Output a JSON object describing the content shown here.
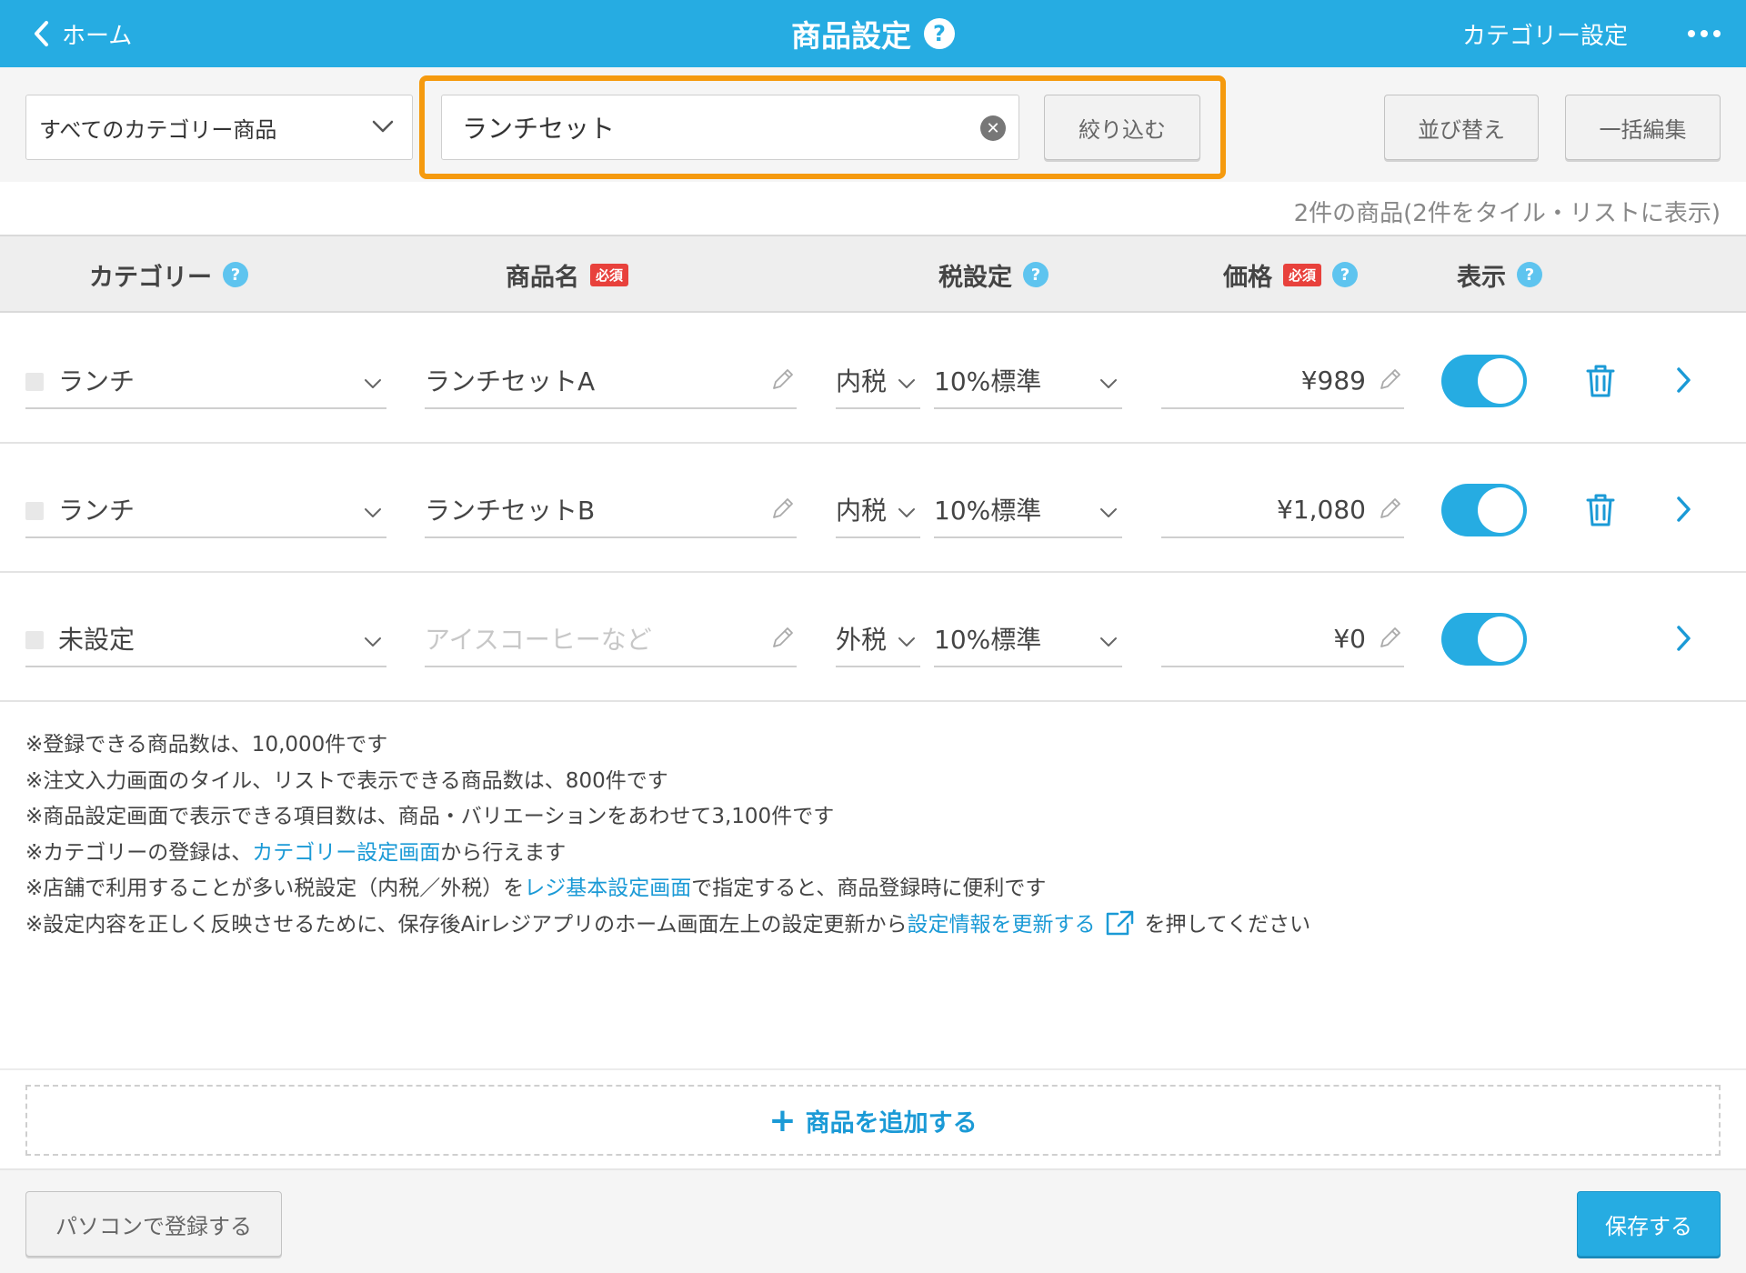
{
  "header": {
    "back_label": "ホーム",
    "title": "商品設定",
    "help": "?",
    "category_settings": "カテゴリー設定"
  },
  "toolbar": {
    "category_filter": "すべてのカテゴリー商品",
    "search_value": "ランチセット",
    "filter_button": "絞り込む",
    "sort_button": "並び替え",
    "bulk_edit_button": "一括編集"
  },
  "summary": "2件の商品(2件をタイル・リストに表示)",
  "table": {
    "columns": {
      "category": "カテゴリー",
      "name": "商品名",
      "tax": "税設定",
      "price": "価格",
      "display": "表示"
    },
    "required_badge": "必須",
    "help": "?",
    "rows": [
      {
        "category": "ランチ",
        "name": "ランチセットA",
        "tax_type": "内税",
        "tax_rate": "10%標準",
        "price": "¥989",
        "display": true,
        "deletable": true
      },
      {
        "category": "ランチ",
        "name": "ランチセットB",
        "tax_type": "内税",
        "tax_rate": "10%標準",
        "price": "¥1,080",
        "display": true,
        "deletable": true
      },
      {
        "category": "未設定",
        "name": "",
        "name_placeholder": "アイスコーヒーなど",
        "tax_type": "外税",
        "tax_rate": "10%標準",
        "price": "¥0",
        "display": true,
        "deletable": false
      }
    ]
  },
  "notes": {
    "n1": "※登録できる商品数は、10,000件です",
    "n2": "※注文入力画面のタイル、リストで表示できる商品数は、800件です",
    "n3": "※商品設定画面で表示できる項目数は、商品・バリエーションをあわせて3,100件です",
    "n4_pre": "※カテゴリーの登録は、",
    "n4_link": "カテゴリー設定画面",
    "n4_post": "から行えます",
    "n5_pre": "※店舗で利用することが多い税設定（内税／外税）を",
    "n5_link": "レジ基本設定画面",
    "n5_post": "で指定すると、商品登録時に便利です",
    "n6_pre": "※設定内容を正しく反映させるために、保存後Airレジアプリのホーム画面左上の設定更新から",
    "n6_link": "設定情報を更新する",
    "n6_post": "を押してください"
  },
  "add_product": "商品を追加する",
  "footer": {
    "pc_register": "パソコンで登録する",
    "save": "保存する"
  },
  "colors": {
    "header_bg": "#26ace2",
    "highlight": "#f59a0e",
    "link": "#1b9ad6",
    "required": "#e8413c",
    "toggle_on": "#26ace2"
  }
}
